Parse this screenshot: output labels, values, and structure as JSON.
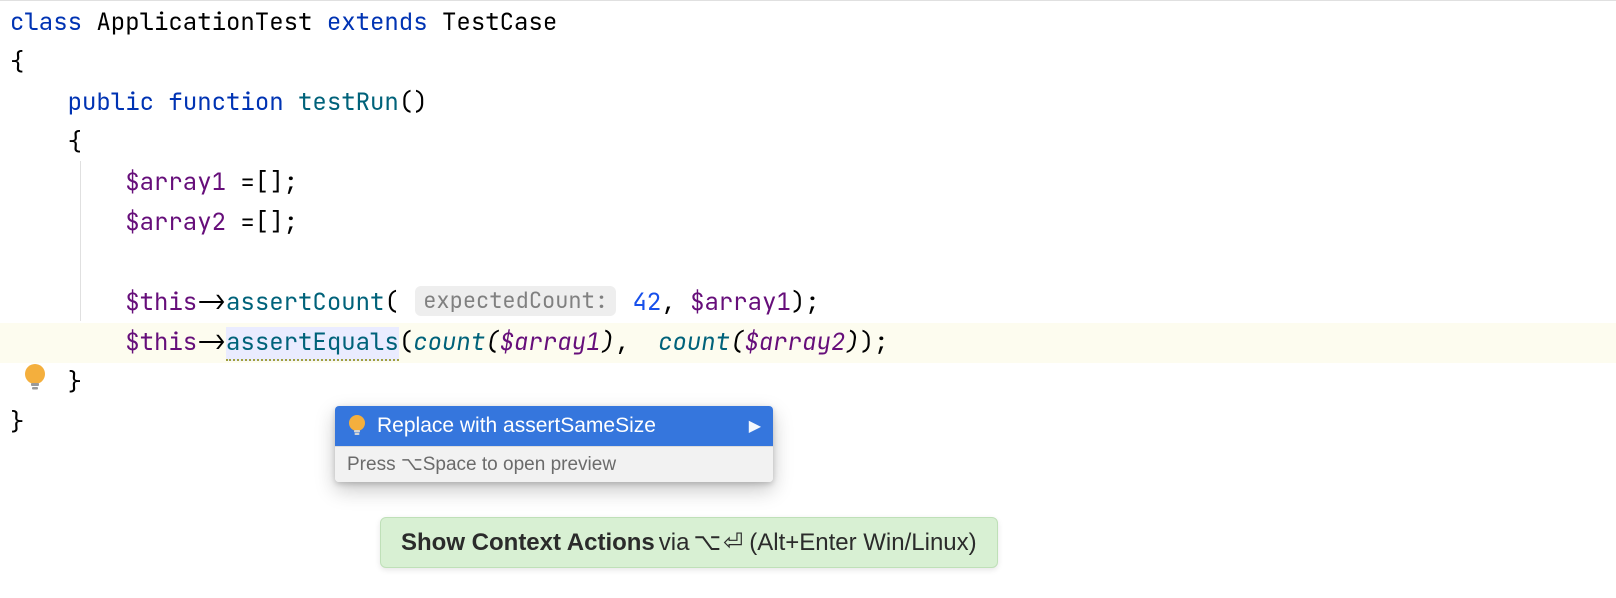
{
  "code": {
    "kw_class": "class",
    "cls_name": "ApplicationTest",
    "kw_extends": "extends",
    "cls_parent": "TestCase",
    "brace_open": "{",
    "brace_close": "}",
    "kw_public": "public",
    "kw_function": "function",
    "fn_name": "testRun",
    "fn_parens": "()",
    "var_array1": "$array1",
    "var_array2": "$array2",
    "assign_empty": " =[];",
    "var_this": "$this",
    "arrow": "->",
    "fn_assertCount": "assertCount",
    "hint_expectedCount": "expectedCount:",
    "num_42": "42",
    "comma_space": ", ",
    "paren_open": "(",
    "paren_close": ")",
    "semi": ";",
    "fn_assertEquals": "assertEquals",
    "fn_count": "count"
  },
  "popup": {
    "action": "Replace with assertSameSize",
    "hint": "Press ⌥Space to open preview"
  },
  "banner": {
    "strong": "Show Context Actions",
    "via": " via ",
    "mac_shortcut": "⌥⏎",
    "alt_text": " (Alt+Enter Win/Linux)"
  }
}
